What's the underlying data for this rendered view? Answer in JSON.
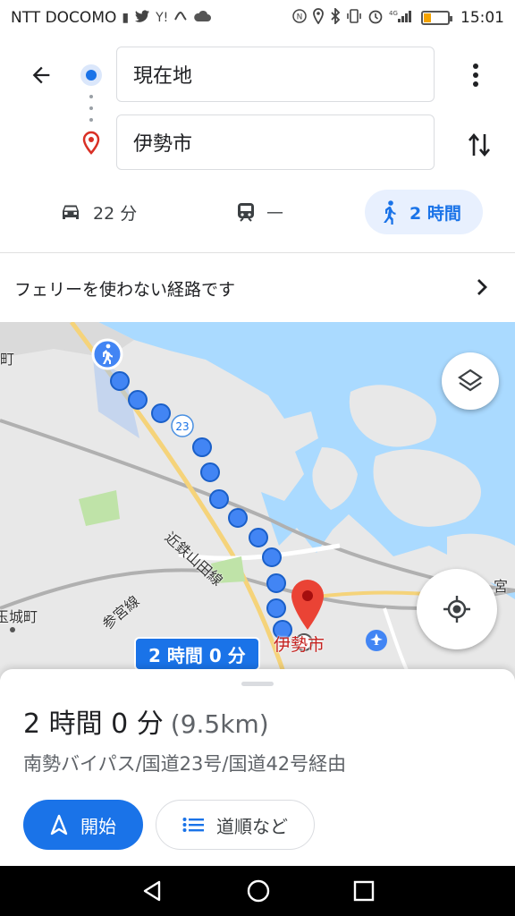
{
  "status_bar": {
    "carrier": "NTT DOCOMO",
    "time": "15:01",
    "battery_level": 0.3,
    "signal": "4G"
  },
  "header": {
    "origin": "現在地",
    "destination": "伊勢市"
  },
  "modes": {
    "car": "22 分",
    "train": "—",
    "walk": "2 時間"
  },
  "notice": {
    "text": "フェリーを使わない経路です"
  },
  "map": {
    "route_time_label": "2 時間 0 分",
    "labels": {
      "kintetsu": "近鉄山田線",
      "sangu": "参宮線",
      "town_left": "玉城町",
      "town_right": "宮",
      "dest": "伊勢市",
      "left_edge": "町",
      "route_no": "23"
    },
    "colors": {
      "water": "#aadaff",
      "land": "#e8e8e8",
      "route": "#4285f4",
      "pin": "#ea4335"
    }
  },
  "sheet": {
    "duration": "2 時間 0 分",
    "distance": "(9.5km)",
    "via": "南勢バイパス/国道23号/国道42号経由",
    "start_label": "開始",
    "steps_label": "道順など"
  }
}
